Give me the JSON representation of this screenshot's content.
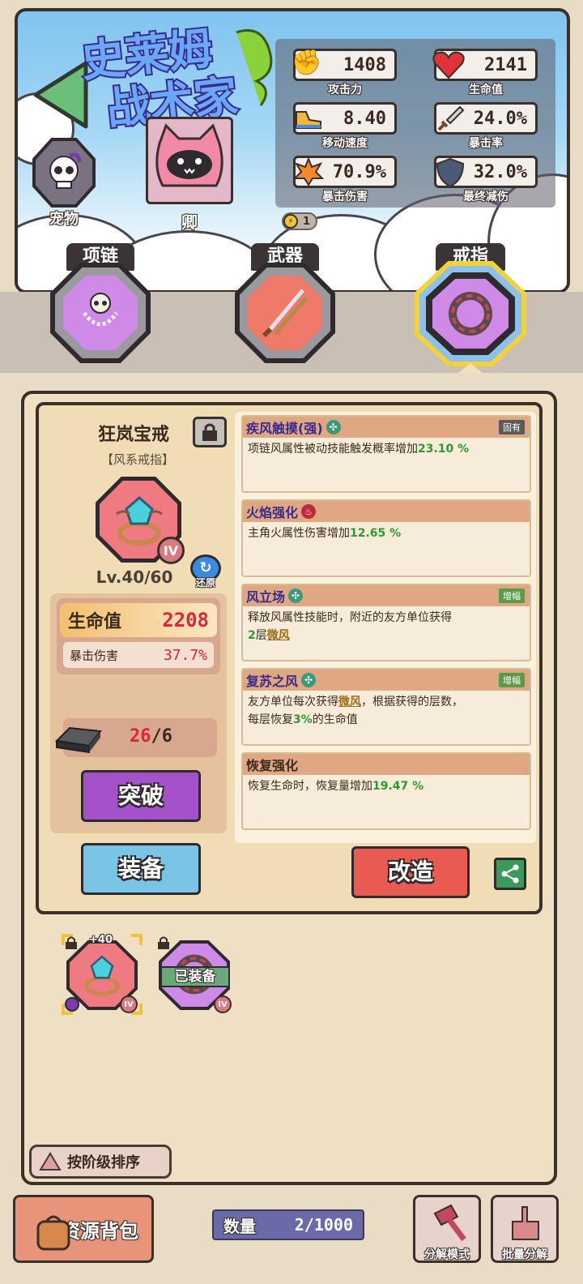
{
  "title_logo": "史莱姆战术家",
  "stats": {
    "attack": {
      "value": "1408",
      "label": "攻击力"
    },
    "hp": {
      "value": "2141",
      "label": "生命值"
    },
    "speed": {
      "value": "8.40",
      "label": "移动速度"
    },
    "crit_rate": {
      "value": "24.0%",
      "label": "暴击率"
    },
    "crit_dmg": {
      "value": "70.9%",
      "label": "暴击伤害"
    },
    "final_reduction": {
      "value": "32.0%",
      "label": "最终减伤"
    }
  },
  "pet_label": "宠物",
  "character_name": "卿",
  "energy": "1",
  "slots": {
    "necklace": "项链",
    "weapon": "武器",
    "ring": "戒指"
  },
  "item": {
    "name": "狂岚宝戒",
    "type": "【风系戒指】",
    "rank": "IV",
    "level": "Lv.40/60",
    "reset": "还原",
    "main_stat": {
      "label": "生命值",
      "value": "2208"
    },
    "sub_stat": {
      "label": "暴击伤害",
      "value": "37.7%"
    },
    "material_have": "26",
    "material_need": "/6",
    "breakthrough": "突破",
    "equip": "装备",
    "reforge": "改造"
  },
  "skills": [
    {
      "name": "疾风触摸(强)",
      "tag": "固有",
      "text": "项链风属性被动技能触发概率增加",
      "value": "23.10 %"
    },
    {
      "name": "火焰强化",
      "text": "主角火属性伤害增加",
      "value": "12.65 %"
    },
    {
      "name": "风立场",
      "tag": "增幅",
      "text_a": "释放风属性技能时，附近的友方单位获得",
      "num": "2",
      "text_b": "层",
      "link": "微风"
    },
    {
      "name": "复苏之风",
      "tag": "增幅",
      "text_a": "友方单位每次获得",
      "link": "微风",
      "text_b": "，根据获得的层数，",
      "text_c": "每层恢复",
      "pct": "3%",
      "text_d": "的生命值"
    },
    {
      "name": "恢复强化",
      "text": "恢复生命时，恢复量增加",
      "value": "19.47 %"
    }
  ],
  "inventory": [
    {
      "bonus": "+40",
      "rank": "IV"
    },
    {
      "status": "已装备",
      "rank": "IV"
    }
  ],
  "sort_label": "按阶级排序",
  "bag_label": "资源背包",
  "count_label": "数量",
  "count_value": "2/1000",
  "dismantle_mode": "分解模式",
  "batch_dismantle": "批量分解",
  "colors": {
    "accent_purple": "#a452c9",
    "red_value": "#d8263a",
    "green_value": "#2f9a2f"
  }
}
